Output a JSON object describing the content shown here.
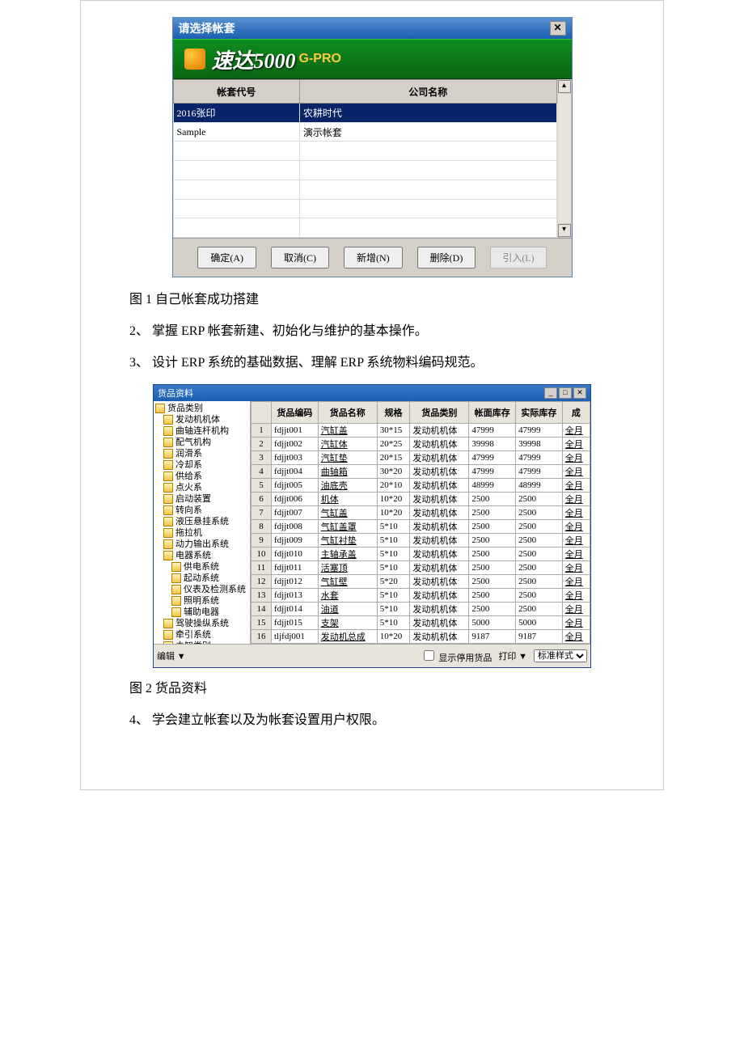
{
  "dlg1": {
    "title": "请选择帐套",
    "banner_text": "速达5000",
    "banner_sub": "G-PRO",
    "cols": [
      "帐套代号",
      "公司名称"
    ],
    "rows": [
      {
        "code": "2016张印",
        "name": "农耕时代"
      },
      {
        "code": "Sample",
        "name": "演示帐套"
      }
    ],
    "buttons": {
      "ok": "确定(A)",
      "cancel": "取消(C)",
      "new": "新增(N)",
      "del": "删除(D)",
      "imp": "引入(L)"
    }
  },
  "texts": {
    "cap1": "图 1 自己帐套成功搭建",
    "p2": "2、 掌握 ERP 帐套新建、初始化与维护的基本操作。",
    "p3": "3、 设计 ERP 系统的基础数据、理解 ERP 系统物料编码规范。",
    "cap2": "图 2 货品资料",
    "p4": "4、 学会建立帐套以及为帐套设置用户权限。"
  },
  "dlg2": {
    "title": "货品资料",
    "tree": [
      "货品类别",
      "发动机机体",
      "曲轴连杆机构",
      "配气机构",
      "润滑系",
      "冷却系",
      "供给系",
      "点火系",
      "启动装置",
      "转向系",
      "液压悬挂系统",
      "拖拉机",
      "动力输出系统",
      "电器系统",
      "供电系统",
      "起动系统",
      "仪表及检测系统",
      "照明系统",
      "辅助电器",
      "驾驶操纵系统",
      "牵引系统",
      "未知类别"
    ],
    "tree_indent": [
      0,
      1,
      1,
      1,
      1,
      1,
      1,
      1,
      1,
      1,
      1,
      1,
      1,
      1,
      2,
      2,
      2,
      2,
      2,
      1,
      1,
      1
    ],
    "cols": [
      "",
      "货品编码",
      "货品名称",
      "规格",
      "货品类别",
      "帐面库存",
      "实际库存",
      "成"
    ],
    "rows": [
      [
        "1",
        "fdjjt001",
        "汽缸盖",
        "30*15",
        "发动机机体",
        "47999",
        "47999",
        "全月"
      ],
      [
        "2",
        "fdjjt002",
        "汽缸体",
        "20*25",
        "发动机机体",
        "39998",
        "39998",
        "全月"
      ],
      [
        "3",
        "fdjjt003",
        "汽缸垫",
        "20*15",
        "发动机机体",
        "47999",
        "47999",
        "全月"
      ],
      [
        "4",
        "fdjjt004",
        "曲轴箱",
        "30*20",
        "发动机机体",
        "47999",
        "47999",
        "全月"
      ],
      [
        "5",
        "fdjjt005",
        "油底壳",
        "20*10",
        "发动机机体",
        "48999",
        "48999",
        "全月"
      ],
      [
        "6",
        "fdjjt006",
        "机体",
        "10*20",
        "发动机机体",
        "2500",
        "2500",
        "全月"
      ],
      [
        "7",
        "fdjjt007",
        "气缸盖",
        "10*20",
        "发动机机体",
        "2500",
        "2500",
        "全月"
      ],
      [
        "8",
        "fdjjt008",
        "气缸盖罩",
        "5*10",
        "发动机机体",
        "2500",
        "2500",
        "全月"
      ],
      [
        "9",
        "fdjjt009",
        "气缸衬垫",
        "5*10",
        "发动机机体",
        "2500",
        "2500",
        "全月"
      ],
      [
        "10",
        "fdjjt010",
        "主轴承盖",
        "5*10",
        "发动机机体",
        "2500",
        "2500",
        "全月"
      ],
      [
        "11",
        "fdjjt011",
        "活塞顶",
        "5*10",
        "发动机机体",
        "2500",
        "2500",
        "全月"
      ],
      [
        "12",
        "fdjjt012",
        "气缸壁",
        "5*20",
        "发动机机体",
        "2500",
        "2500",
        "全月"
      ],
      [
        "13",
        "fdjjt013",
        "水套",
        "5*10",
        "发动机机体",
        "2500",
        "2500",
        "全月"
      ],
      [
        "14",
        "fdjjt014",
        "油道",
        "5*10",
        "发动机机体",
        "2500",
        "2500",
        "全月"
      ],
      [
        "15",
        "fdjjt015",
        "支架",
        "5*10",
        "发动机机体",
        "5000",
        "5000",
        "全月"
      ],
      [
        "16",
        "tljfdj001",
        "发动机总成",
        "10*20",
        "发动机机体",
        "9187",
        "9187",
        "全月"
      ]
    ],
    "statusbar": {
      "edit": "编辑 ▼",
      "chk": "显示停用货品",
      "print": "打印 ▼",
      "sel": "标准样式"
    }
  }
}
